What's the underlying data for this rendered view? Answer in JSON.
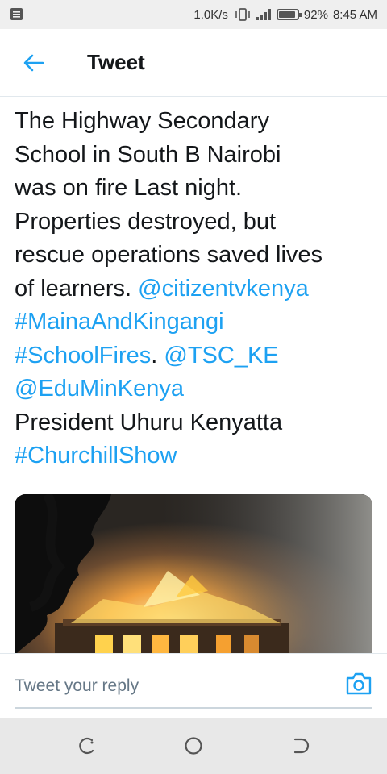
{
  "status_bar": {
    "net_speed": "1.0K/s",
    "battery": "92%",
    "battery_level": 0.92,
    "time": "8:45 AM"
  },
  "header": {
    "title": "Tweet"
  },
  "tweet": {
    "lines": [
      [
        {
          "text": "The Highway Secondary",
          "type": "text"
        }
      ],
      [
        {
          "text": "School in South B Nairobi",
          "type": "text"
        }
      ],
      [
        {
          "text": "was on fire Last night.",
          "type": "text"
        }
      ],
      [
        {
          "text": "Properties destroyed, but",
          "type": "text"
        }
      ],
      [
        {
          "text": "rescue operations saved lives",
          "type": "text"
        }
      ],
      [
        {
          "text": "of learners. ",
          "type": "text"
        },
        {
          "text": "@citizentvkenya",
          "type": "mention"
        }
      ],
      [
        {
          "text": "#MainaAndKingangi",
          "type": "hashtag"
        }
      ],
      [
        {
          "text": "#SchoolFires",
          "type": "hashtag"
        },
        {
          "text": ". ",
          "type": "text"
        },
        {
          "text": "@TSC_KE",
          "type": "mention"
        }
      ],
      [
        {
          "text": "@EduMinKenya",
          "type": "mention"
        }
      ],
      [
        {
          "text": "President Uhuru Kenyatta",
          "type": "text"
        }
      ],
      [
        {
          "text": "#ChurchillShow",
          "type": "hashtag"
        }
      ]
    ]
  },
  "reply": {
    "placeholder": "Tweet your reply"
  },
  "colors": {
    "link": "#1da1f2",
    "text": "#14171a"
  },
  "icons": {
    "back": "arrow-left-icon",
    "camera": "camera-icon",
    "recents": "recents-icon",
    "home": "home-icon",
    "nav_back": "back-icon"
  }
}
